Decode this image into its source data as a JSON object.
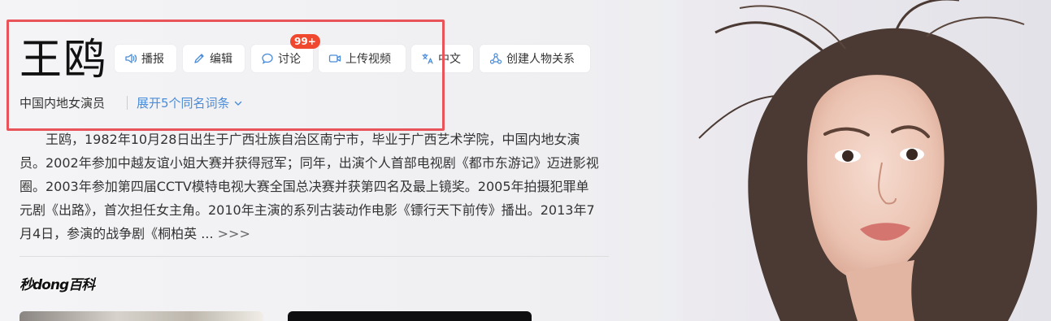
{
  "entry": {
    "title": "王鸥",
    "subtitle": "中国内地女演员",
    "expand_label": "展开5个同名词条"
  },
  "toolbar": {
    "play_label": "播报",
    "edit_label": "编辑",
    "discuss_label": "讨论",
    "discuss_badge": "99+",
    "upload_label": "上传视频",
    "lang_label": "中文",
    "relation_label": "创建人物关系"
  },
  "summary": {
    "text": "王鸥，1982年10月28日出生于广西壮族自治区南宁市，毕业于广西艺术学院，中国内地女演员。2002年参加中越友谊小姐大赛并获得冠军；同年，出演个人首部电视剧《都市东游记》迈进影视圈。2003年参加第四届CCTV模特电视大赛全国总决赛并获第四名及最上镜奖。2005年拍摄犯罪单元剧《出路》，首次担任女主角。2010年主演的系列古装动作电影《镖行天下前传》播出。2013年7月4日，参演的战争剧《桐柏英 ...",
    "more_label": ">>>"
  },
  "watermark": "秒dong百科",
  "colors": {
    "accent": "#4a8cd8",
    "badge": "#f0482e",
    "highlight": "#e8545a"
  }
}
